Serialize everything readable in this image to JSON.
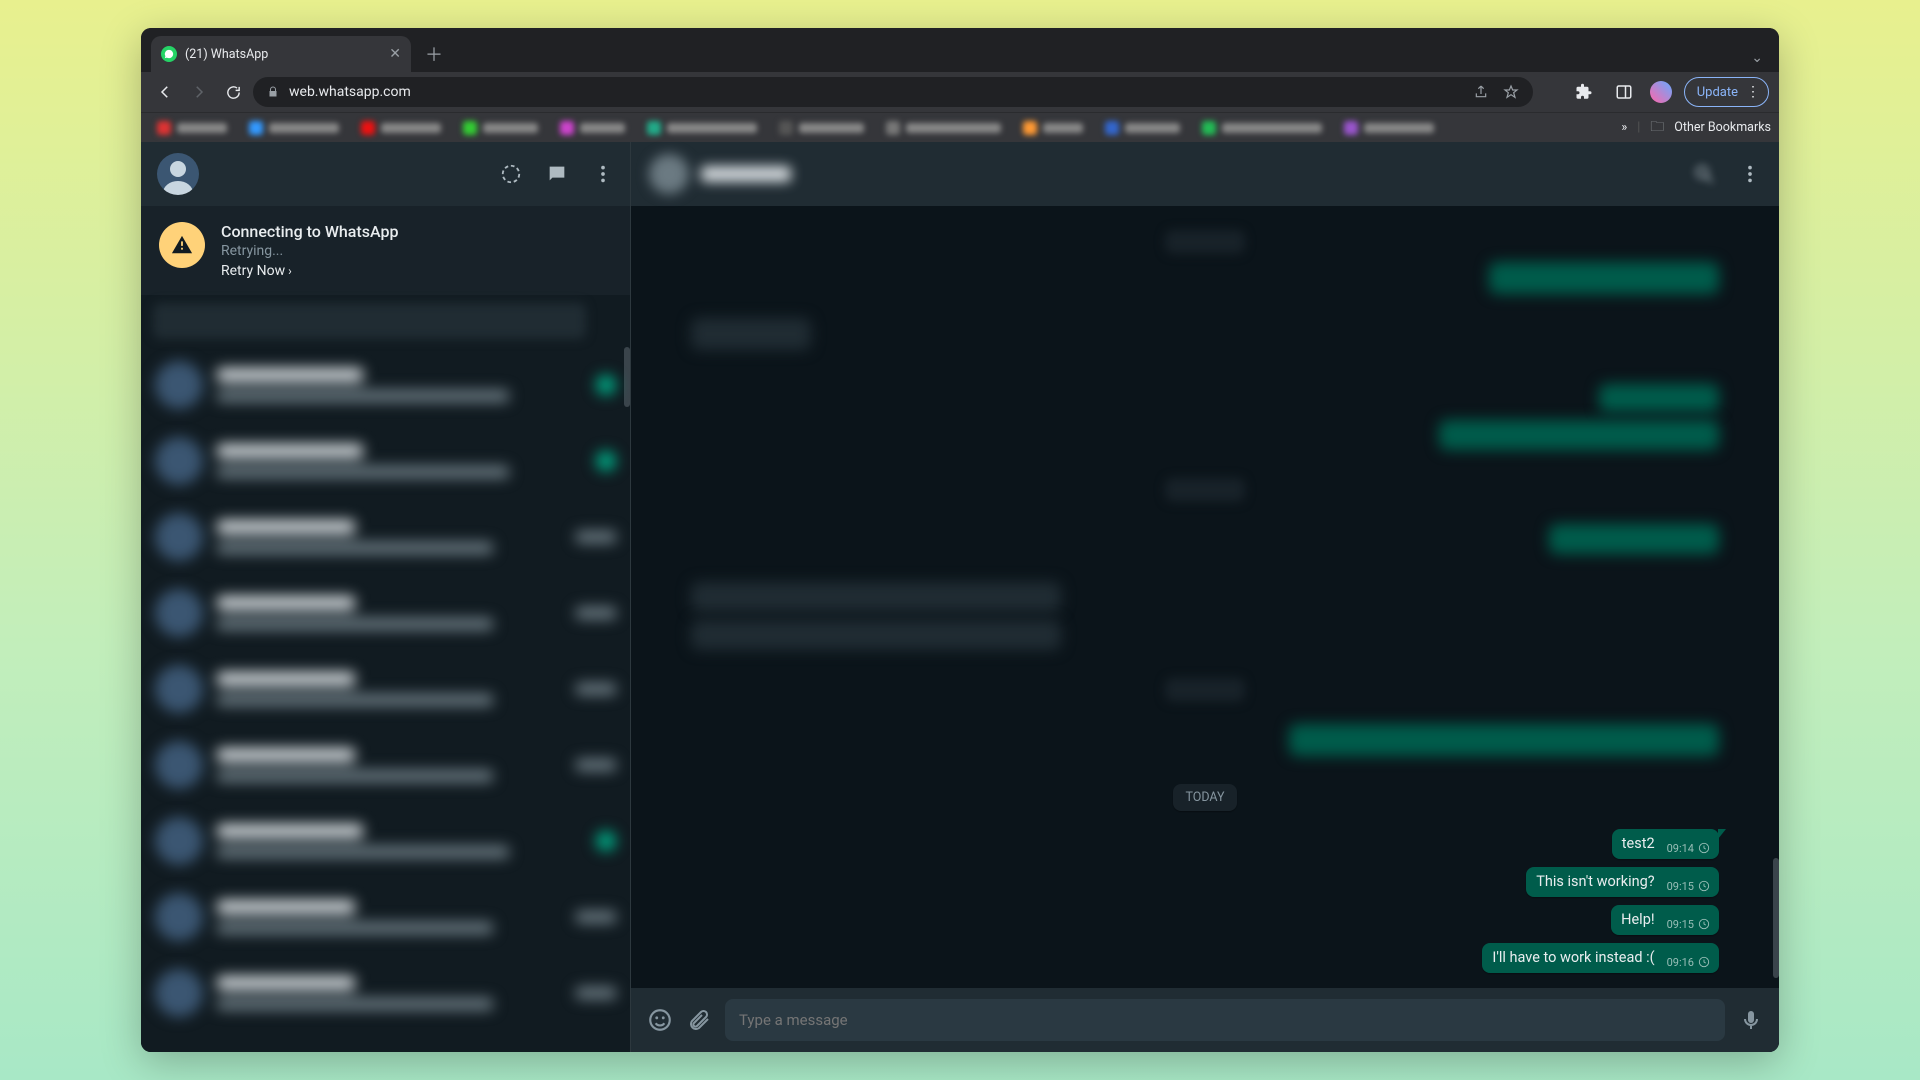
{
  "browser": {
    "tab_title": "(21) WhatsApp",
    "url": "web.whatsapp.com",
    "update_label": "Update",
    "other_bookmarks": "Other Bookmarks",
    "bookmarks_chevron": "»"
  },
  "sidebar": {
    "alert": {
      "title": "Connecting to WhatsApp",
      "subtitle": "Retrying...",
      "retry_label": "Retry Now"
    }
  },
  "conversation": {
    "day_label": "TODAY",
    "composer_placeholder": "Type a message",
    "messages": [
      {
        "text": "test2",
        "time": "09:14"
      },
      {
        "text": "This isn't working?",
        "time": "09:15"
      },
      {
        "text": "Help!",
        "time": "09:15"
      },
      {
        "text": "I'll have to work instead :(",
        "time": "09:16"
      }
    ]
  }
}
